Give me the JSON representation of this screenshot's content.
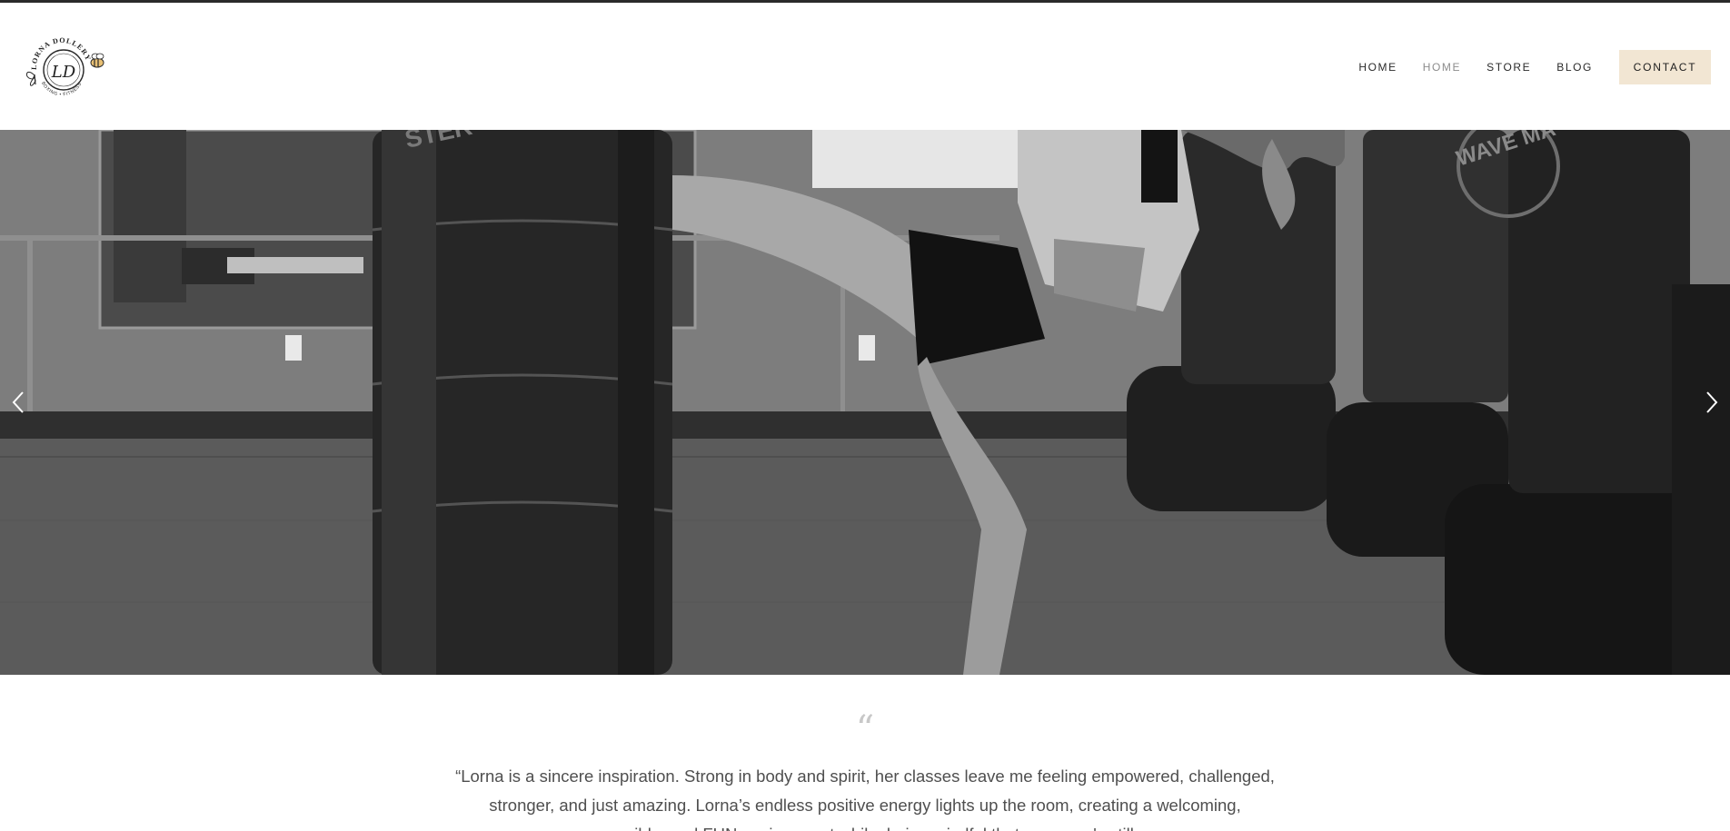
{
  "brand": {
    "logo_top_text": "LORNA DOLLERY",
    "logo_monogram": "LD",
    "logo_bottom_text": "BOXING • FITNESS"
  },
  "nav": {
    "items": [
      {
        "label": "HOME",
        "state": "active"
      },
      {
        "label": "HOME",
        "state": "dim"
      },
      {
        "label": "STORE",
        "state": "normal"
      },
      {
        "label": "BLOG",
        "state": "normal"
      }
    ],
    "contact_label": "CONTACT"
  },
  "hero": {
    "prev_icon": "chevron-left-icon",
    "next_icon": "chevron-right-icon",
    "bag_text_left": "STER",
    "bag_text_right": "WAVE MA"
  },
  "testimonial": {
    "quote_mark": "“",
    "text": "“Lorna is a sincere inspiration. Strong in body and spirit, her classes leave me feeling empowered, challenged, stronger, and just amazing. Lorna’s endless positive energy lights up the room, creating a welcoming, accessible, and FUN environment while, being mindful that everyone's still..."
  },
  "colors": {
    "contact_bg": "#f2e6d3",
    "top_strip": "#2b2b2b",
    "nav_text": "#2a2a2a",
    "nav_dim": "#8c8c8c",
    "quote_text": "#4f4f4f"
  }
}
